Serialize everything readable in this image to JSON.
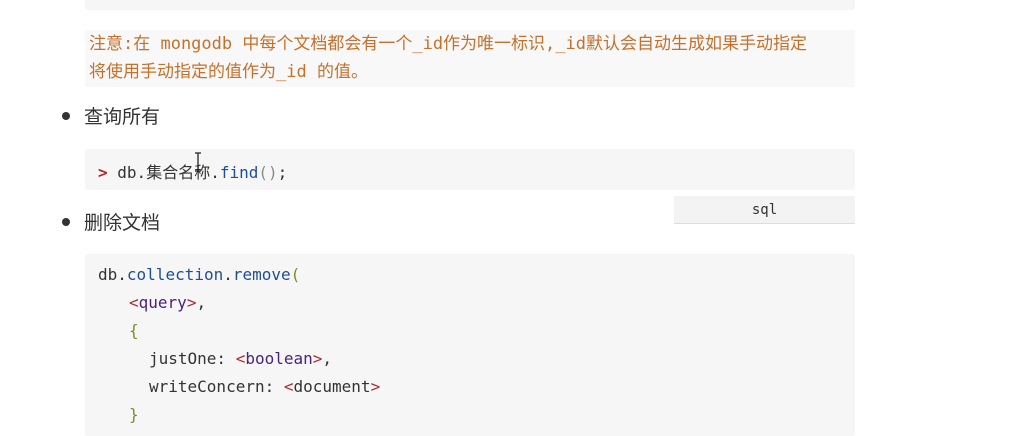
{
  "note": {
    "line1": "注意:在 mongodb 中每个文档都会有一个_id作为唯一标识,_id默认会自动生成如果手动指定",
    "line2": "将使用手动指定的值作为_id 的值。"
  },
  "bullets": {
    "query_all": "查询所有",
    "delete_doc": "删除文档"
  },
  "code_find": {
    "prompt": ">",
    "db": "db.",
    "collection": "集合名称",
    "dot": ".",
    "method": "find",
    "parens": "()",
    "semicolon": ";"
  },
  "lang_label": "sql",
  "code_remove": {
    "db": "db.",
    "collection": "collection",
    "dot": ".",
    "method": "remove",
    "open_paren": "(",
    "query_open": "<",
    "query_name": "query",
    "query_close": ">",
    "comma": ",",
    "open_brace": "{",
    "justone_key": "justOne: ",
    "bool_open": "<",
    "bool_name": "boolean",
    "bool_close": ">",
    "comma2": ",",
    "writeconcern_key": "writeConcern: ",
    "doc_open": "<",
    "doc_name": "document",
    "doc_close": ">",
    "close_brace": "}"
  },
  "icons": {
    "cursor": "text-cursor-icon"
  }
}
